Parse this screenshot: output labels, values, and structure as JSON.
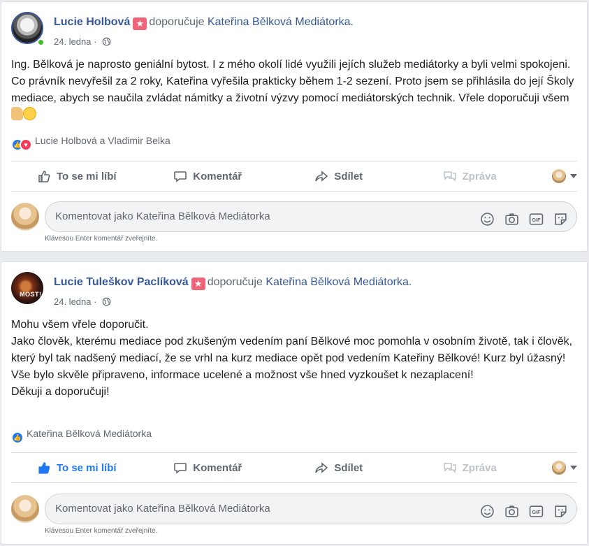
{
  "posts": [
    {
      "author": "Lucie Holbová",
      "recommends": "doporučuje",
      "page": "Kateřina Bělková Mediátorka.",
      "date": "24. ledna",
      "separator": "·",
      "paragraphs": [
        "Ing. Bělková je naprosto geniální bytost. I z mého okolí lidé využili jejích služeb mediátorky a byli velmi spokojeni. Co právník nevyřešil za 2 roky, Kateřina vyřešila prakticky během 1-2 sezení. Proto jsem se přihlásila do její Školy mediace, abych se naučila zvládat námitky a životní výzvy pomocí mediátorských technik. Vřele doporučuji všem"
      ],
      "reactions_text": "Lucie Holbová a Vladimir Belka",
      "reaction_types": [
        "like-icon",
        "love-icon"
      ],
      "liked": false
    },
    {
      "author": "Lucie Tuleškov Paclíková",
      "recommends": "doporučuje",
      "page": "Kateřina Bělková Mediátorka.",
      "date": "24. ledna",
      "separator": "·",
      "avatar_text": "MOST!",
      "paragraphs": [
        "Mohu všem vřele doporučit.",
        "Jako člověk, kterému mediace pod zkušeným vedením paní Bělkové moc pomohla v osobním životě, tak i člověk, který byl tak nadšený mediací, že se vrhl na kurz mediace opět pod vedením Kateřiny Bělkové! Kurz byl úžasný! Vše bylo skvěle připraveno, informace ucelené a možnost vše hned vyzkoušet k nezaplacení!",
        "Děkuji a doporučuji!"
      ],
      "reactions_text": "Kateřina Bělková Mediátorka",
      "reaction_types": [
        "like-icon"
      ],
      "liked": true
    }
  ],
  "actions": {
    "like": "To se mi líbí",
    "comment": "Komentář",
    "share": "Sdílet",
    "message": "Zpráva"
  },
  "comment_box": {
    "placeholder": "Komentovat jako Kateřina Bělková Mediátorka",
    "hint": "Klávesou Enter komentář zveřejníte."
  },
  "colors": {
    "link": "#365899",
    "like_active": "#2078f4",
    "recommend_badge": "#f0647a",
    "online": "#42b72a"
  }
}
